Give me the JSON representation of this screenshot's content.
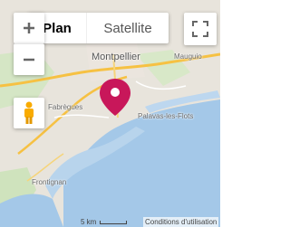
{
  "map_type": {
    "plan_label": "Plan",
    "satellite_label": "Satellite"
  },
  "places": {
    "montpellier": "Montpellier",
    "mauguio": "Mauguio",
    "fabregues": "Fabrègues",
    "frontignan": "Frontignan",
    "palavas": "Palavas-les-Flots"
  },
  "footer": {
    "scale": "5 km",
    "terms": "Conditions d'utilisation"
  },
  "icons": [
    "zoom-in-icon",
    "zoom-out-icon",
    "fullscreen-icon",
    "pegman-icon",
    "map-pin-icon"
  ],
  "colors": {
    "pin": "#c8175a",
    "water": "#a4c8e8",
    "land": "#e8e4dc",
    "vegetation": "#cde4b8",
    "highway": "#f6c143"
  }
}
